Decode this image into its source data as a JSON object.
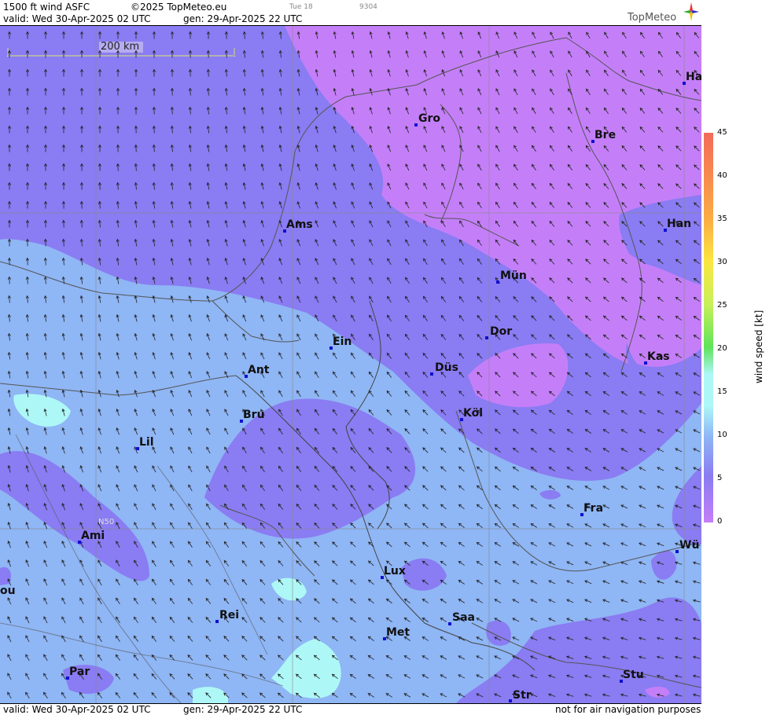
{
  "header": {
    "product": "1500 ft wind ASFC",
    "copyright": "©2025 TopMeteo.eu",
    "day_tag": "Tue 18",
    "code": "9304",
    "valid": "valid:  Wed  30-Apr-2025  02 UTC",
    "gen": "gen: 29-Apr-2025 22 UTC",
    "brand": "TopMeteo"
  },
  "footer": {
    "valid": "valid:  Wed  30-Apr-2025  02 UTC",
    "gen": "gen: 29-Apr-2025 22 UTC",
    "disclaimer": "not for air navigation purposes"
  },
  "map": {
    "scale_label": "200 km",
    "lat_label": "N50",
    "cities": [
      {
        "name": "Gro"
      },
      {
        "name": "Bre"
      },
      {
        "name": "Ha"
      },
      {
        "name": "Ams"
      },
      {
        "name": "Han"
      },
      {
        "name": "Mün"
      },
      {
        "name": "Ein"
      },
      {
        "name": "Dor"
      },
      {
        "name": "Kas"
      },
      {
        "name": "Ant"
      },
      {
        "name": "Düs"
      },
      {
        "name": "Bru"
      },
      {
        "name": "Köl"
      },
      {
        "name": "Lil"
      },
      {
        "name": "Fra"
      },
      {
        "name": "Ami"
      },
      {
        "name": "Wü"
      },
      {
        "name": "ou"
      },
      {
        "name": "Lux"
      },
      {
        "name": "Rei"
      },
      {
        "name": "Saa"
      },
      {
        "name": "Met"
      },
      {
        "name": "Par"
      },
      {
        "name": "Stu"
      },
      {
        "name": "Str"
      }
    ],
    "colors": {
      "lt5": "#c47ff8",
      "lt10": "#8a7cf2",
      "lt15": "#8fb6f5",
      "lt20": "#aef7f7"
    }
  },
  "legend": {
    "title": "wind speed [kt]",
    "ticks": [
      "45",
      "40",
      "35",
      "30",
      "25",
      "20",
      "15",
      "10",
      "5",
      "0"
    ]
  }
}
